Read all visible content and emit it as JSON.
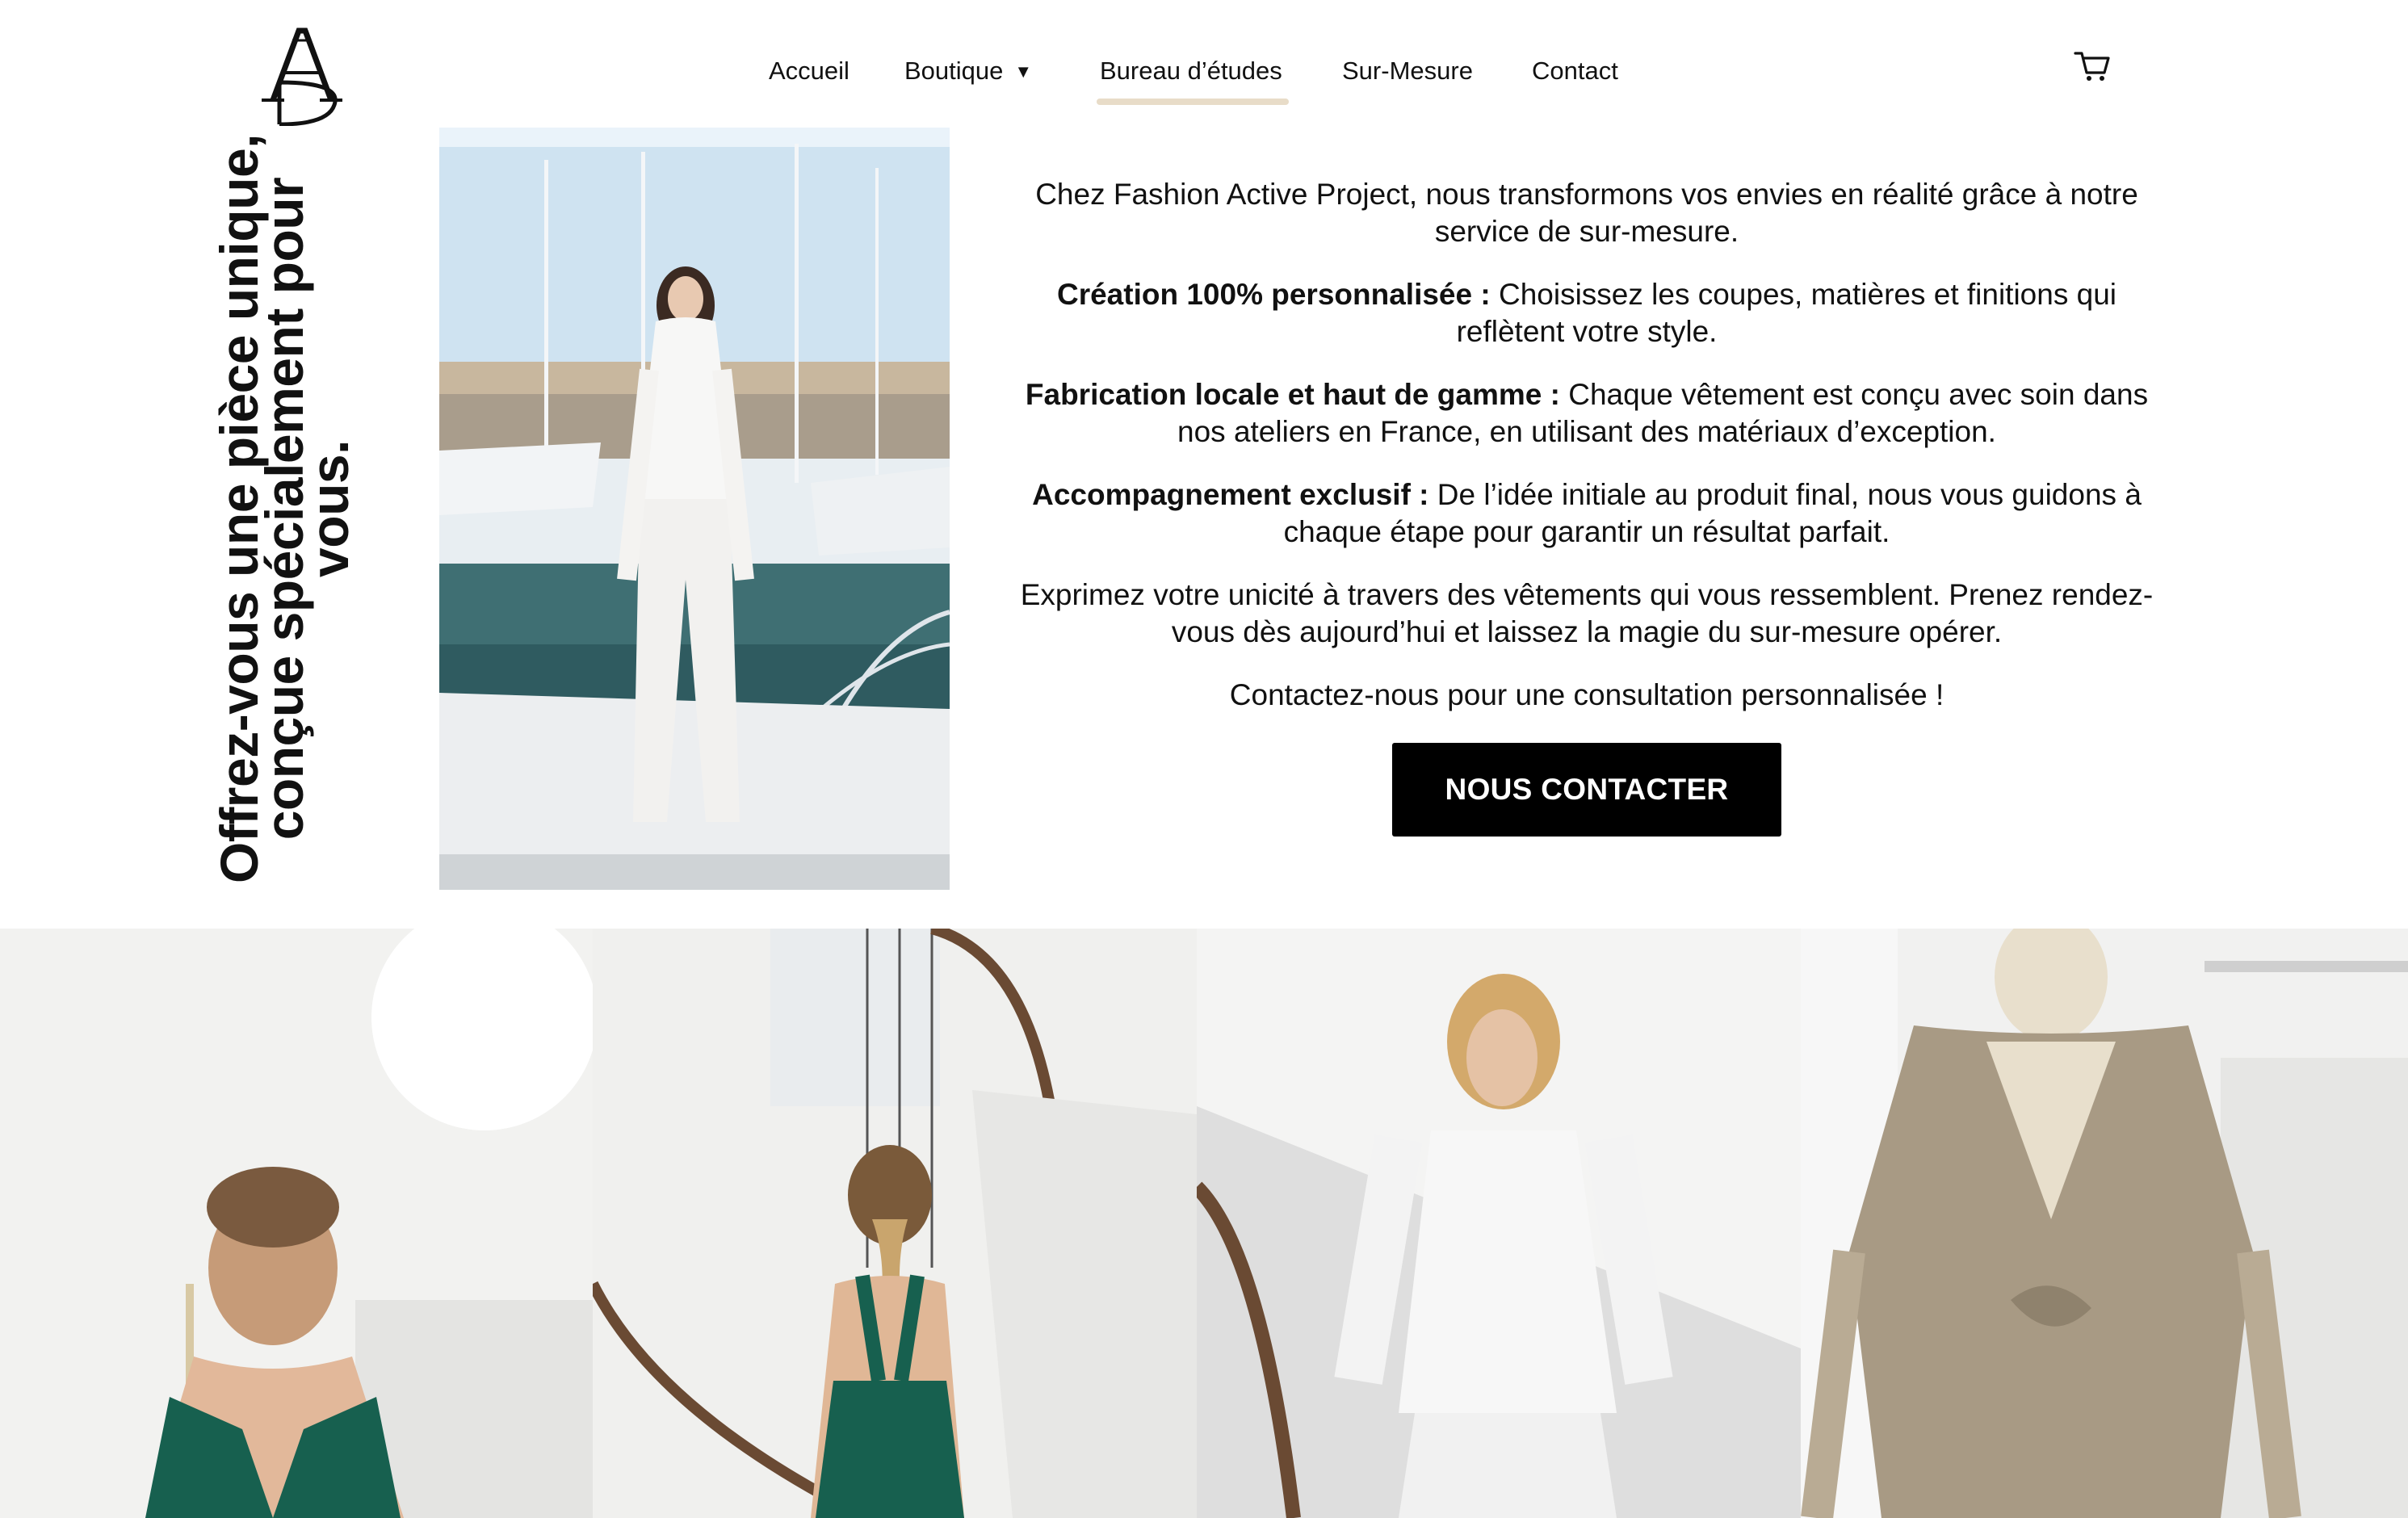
{
  "nav": {
    "items": [
      {
        "label": "Accueil"
      },
      {
        "label": "Boutique",
        "caret": "▼"
      },
      {
        "label": "Bureau d’études"
      },
      {
        "label": "Sur-Mesure"
      },
      {
        "label": "Contact"
      }
    ],
    "active": "Bureau d’études"
  },
  "logo_icon": "monogram-logo",
  "cart_icon": "shopping-cart-icon",
  "vertical_title": "Offrez-vous une pièce unique, conçue spécialement pour vous.",
  "intro": {
    "p1": "Chez Fashion Active Project, nous transformons vos envies en réalité grâce à notre service de sur-mesure.",
    "f1_bold": "Création 100% personnalisée :",
    "f1_text": " Choisissez les coupes, matières et finitions qui reflètent votre style.",
    "f2_bold": "Fabrication locale et haut de gamme :",
    "f2_text": " Chaque vêtement est conçu avec soin dans nos ateliers en France, en utilisant des matériaux d’exception.",
    "f3_bold": "Accompagnement exclusif :",
    "f3_text": " De l’idée initiale au produit final, nous vous guidons à chaque étape pour garantir un résultat parfait.",
    "p2": "Exprimez votre unicité à travers des vêtements qui vous ressemblent. Prenez rendez-vous dès aujourd’hui et laissez la magie du sur-mesure opérer.",
    "p3": "Contactez-nous pour une consultation personnalisée !"
  },
  "cta_label": "NOUS CONTACTER",
  "colors": {
    "accent_underline": "#e8dcc8",
    "button_bg": "#000000",
    "button_text": "#ffffff"
  }
}
